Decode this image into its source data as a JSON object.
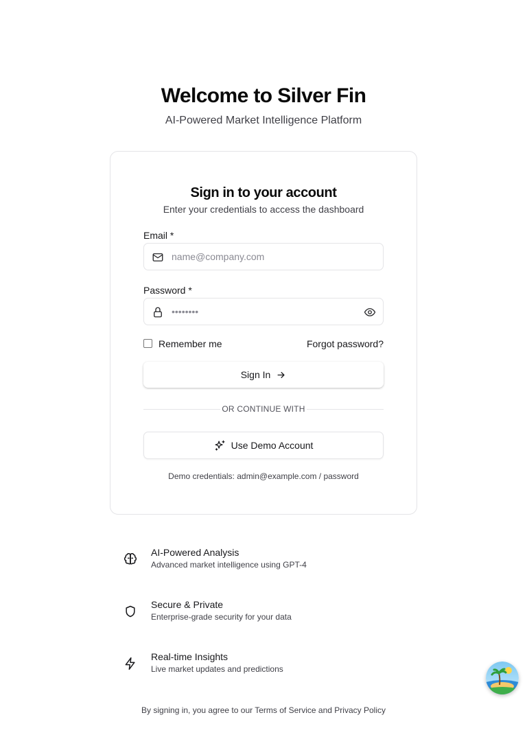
{
  "hero": {
    "title": "Welcome to Silver Fin",
    "subtitle": "AI-Powered Market Intelligence Platform"
  },
  "card": {
    "title": "Sign in to your account",
    "subtitle": "Enter your credentials to access the dashboard",
    "email": {
      "label": "Email *",
      "placeholder": "name@company.com",
      "value": "",
      "icon": "mail-icon"
    },
    "password": {
      "label": "Password *",
      "placeholder": "••••••••",
      "value": "",
      "icon": "lock-icon",
      "toggle_icon": "eye-icon"
    },
    "remember_label": "Remember me",
    "remember_checked": false,
    "forgot_label": "Forgot password?",
    "signin_label": "Sign In",
    "signin_icon": "arrow-right-icon",
    "divider_text": "OR CONTINUE WITH",
    "demo_label": "Use Demo Account",
    "demo_icon": "sparkles-icon",
    "demo_credentials": "Demo credentials: admin@example.com / password"
  },
  "features": [
    {
      "title": "AI-Powered Analysis",
      "description": "Advanced market intelligence using GPT-4",
      "icon": "brain-icon"
    },
    {
      "title": "Secure & Private",
      "description": "Enterprise-grade security for your data",
      "icon": "shield-icon"
    },
    {
      "title": "Real-time Insights",
      "description": "Live market updates and predictions",
      "icon": "zap-icon"
    }
  ],
  "footer": {
    "prefix": "By signing in, you agree to our ",
    "terms": "Terms of Service",
    "and": " and ",
    "privacy": "Privacy Policy"
  },
  "assistant": {
    "icon": "island-avatar-icon"
  },
  "colors": {
    "text_primary": "#0a0a0a",
    "text_muted": "#3f3f46",
    "border": "#e4e4e7"
  }
}
